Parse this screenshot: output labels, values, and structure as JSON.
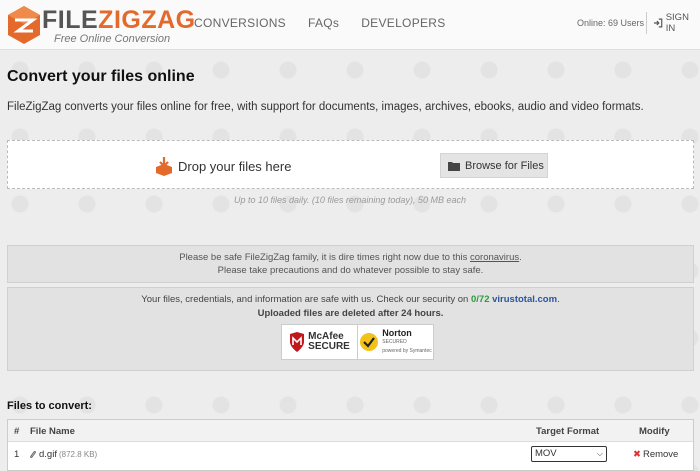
{
  "header": {
    "logo_name_part1": "FILE",
    "logo_name_part2": "ZIGZAG",
    "logo_tagline": "Free Online Conversion",
    "nav": [
      "CONVERSIONS",
      "FAQs",
      "DEVELOPERS"
    ],
    "online_users": "Online: 69 Users",
    "sign_in": "SIGN IN"
  },
  "main": {
    "title": "Convert your files online",
    "intro": "FileZigZag converts your files online for free, with support for documents, images, archives, ebooks, audio and video formats.",
    "drop_text": "Drop your files here",
    "browse_button": "Browse for Files",
    "limits": "Up to 10 files daily. (10 files remaining today), 50 MB each"
  },
  "notice": {
    "line1_prefix": "Please be safe FileZigZag family, it is dire times right now due to this ",
    "line1_link": "coronavirus",
    "line1_suffix": ".",
    "line2": "Please take precautions and do whatever possible to stay safe."
  },
  "security": {
    "line1_prefix": "Your files, credentials, and information are safe with us. Check our security on ",
    "score": "0/72",
    "site": "virustotal.com",
    "line1_suffix": ".",
    "line2": "Uploaded files are deleted after 24 hours.",
    "mcafee_l1": "McAfee",
    "mcafee_l2": "SECURE",
    "norton_l1": "Norton",
    "norton_l2": "SECURED",
    "norton_sub": "powered by Symantec"
  },
  "files": {
    "heading": "Files to convert:",
    "columns": [
      "#",
      "File Name",
      "Target Format",
      "Modify"
    ],
    "rows": [
      {
        "index": "1",
        "name": "d.gif",
        "size": "(872.8 KB)",
        "format": "MOV",
        "action": "Remove"
      }
    ]
  },
  "colors": {
    "brand_orange": "#e36a2a",
    "header_bg": "#fafafa",
    "page_bg": "#ededed",
    "remove_red": "#d33333"
  }
}
